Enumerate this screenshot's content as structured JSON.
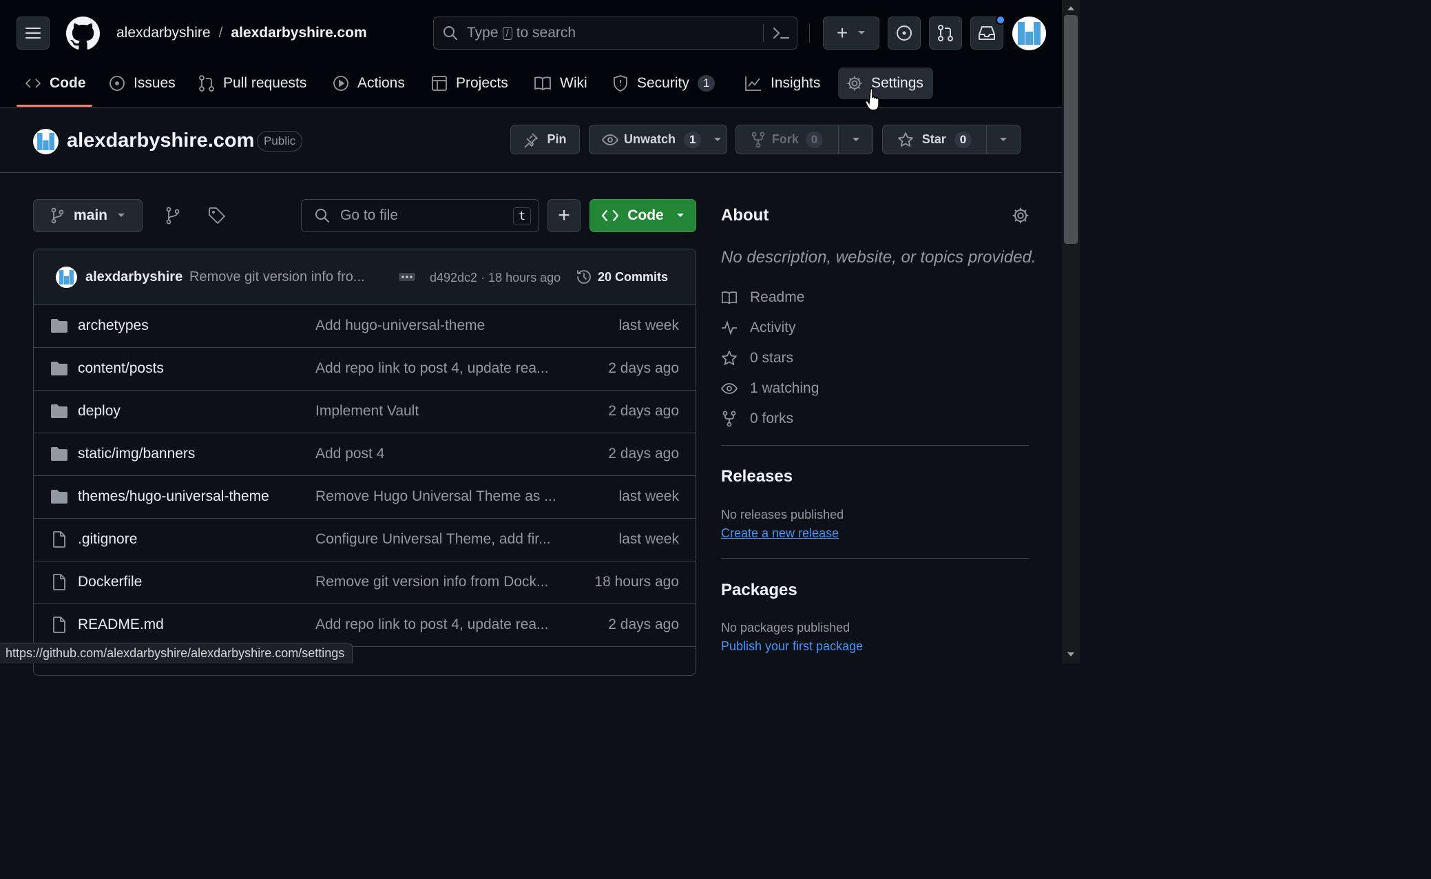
{
  "header": {
    "owner": "alexdarbyshire",
    "separator": "/",
    "repo": "alexdarbyshire.com",
    "search_prefix": "Type",
    "search_key": "/",
    "search_suffix": "to search",
    "plus": "+"
  },
  "tabs": [
    {
      "label": "Code",
      "icon": "code-icon"
    },
    {
      "label": "Issues",
      "icon": "issue-icon"
    },
    {
      "label": "Pull requests",
      "icon": "pull-request-icon"
    },
    {
      "label": "Actions",
      "icon": "play-icon"
    },
    {
      "label": "Projects",
      "icon": "table-icon"
    },
    {
      "label": "Wiki",
      "icon": "book-icon"
    },
    {
      "label": "Security",
      "icon": "shield-icon",
      "count": "1"
    },
    {
      "label": "Insights",
      "icon": "graph-icon"
    },
    {
      "label": "Settings",
      "icon": "gear-icon"
    }
  ],
  "repo_header": {
    "name": "alexdarbyshire.com",
    "visibility": "Public",
    "pin": "Pin",
    "unwatch": "Unwatch",
    "watch_count": "1",
    "fork": "Fork",
    "fork_count": "0",
    "star": "Star",
    "star_count": "0"
  },
  "toolbar": {
    "branch": "main",
    "go_to_file": "Go to file",
    "go_to_file_key": "t",
    "add": "+",
    "code": "Code"
  },
  "commit": {
    "author": "alexdarbyshire",
    "message": "Remove git version info fro...",
    "sha_time": "d492dc2 · 18 hours ago",
    "commits": "20 Commits"
  },
  "files": [
    {
      "name": "archetypes",
      "type": "folder",
      "message": "Add hugo-universal-theme",
      "date": "last week"
    },
    {
      "name": "content/posts",
      "type": "folder",
      "message": "Add repo link to post 4, update rea...",
      "date": "2 days ago"
    },
    {
      "name": "deploy",
      "type": "folder",
      "message": "Implement Vault",
      "date": "2 days ago"
    },
    {
      "name": "static/img/banners",
      "type": "folder",
      "message": "Add post 4",
      "date": "2 days ago"
    },
    {
      "name": "themes/hugo-universal-theme",
      "type": "folder",
      "message": "Remove Hugo Universal Theme as ...",
      "date": "last week"
    },
    {
      "name": ".gitignore",
      "type": "file",
      "message": "Configure Universal Theme, add fir...",
      "date": "last week"
    },
    {
      "name": "Dockerfile",
      "type": "file",
      "message": "Remove git version info from Dock...",
      "date": "18 hours ago"
    },
    {
      "name": "README.md",
      "type": "file",
      "message": "Add repo link to post 4, update rea...",
      "date": "2 days ago"
    }
  ],
  "about": {
    "title": "About",
    "description": "No description, website, or topics provided.",
    "items": [
      {
        "label": "Readme",
        "icon": "book-icon"
      },
      {
        "label": "Activity",
        "icon": "pulse-icon"
      },
      {
        "label": "0 stars",
        "icon": "star-icon"
      },
      {
        "label": "1 watching",
        "icon": "eye-icon"
      },
      {
        "label": "0 forks",
        "icon": "fork-icon"
      }
    ]
  },
  "releases": {
    "title": "Releases",
    "empty": "No releases published",
    "link": "Create a new release"
  },
  "packages": {
    "title": "Packages",
    "empty": "No packages published",
    "link": "Publish your first package"
  },
  "status_url": "https://github.com/alexdarbyshire/alexdarbyshire.com/settings",
  "colors": {
    "background": "#0d1117",
    "header": "#010409",
    "accent_green": "#238636",
    "link_blue": "#4493f8",
    "active_tab": "#f78166"
  }
}
